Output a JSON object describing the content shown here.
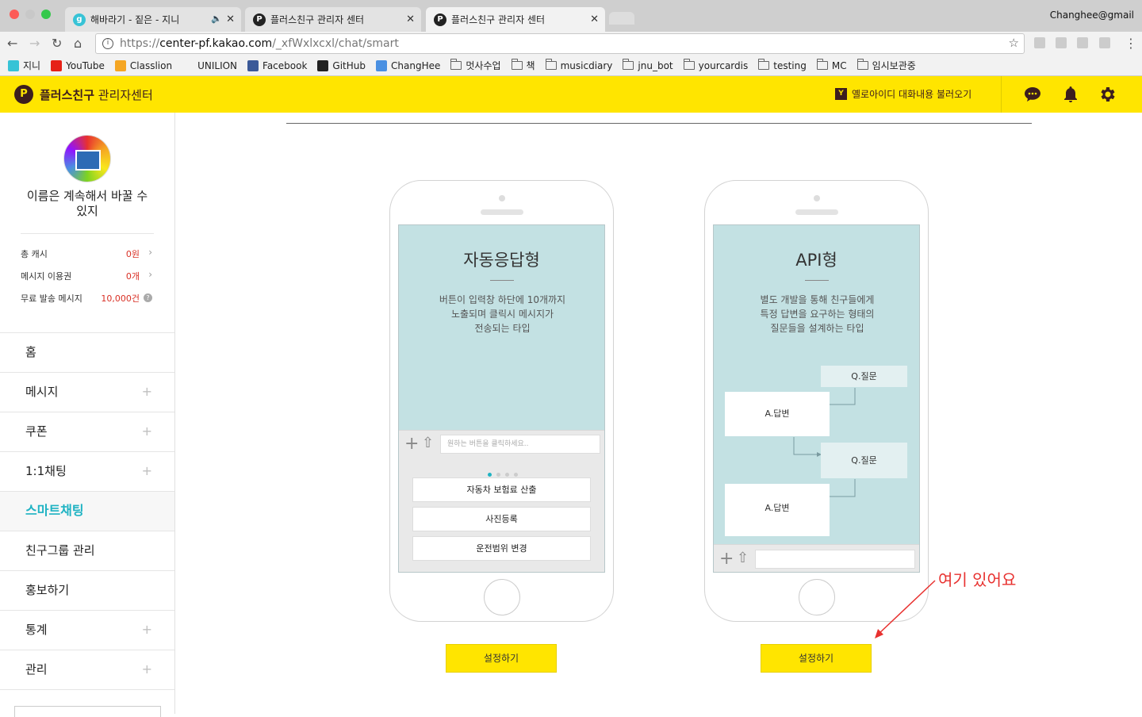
{
  "browser": {
    "tabs": [
      {
        "title": "해바라기 - 짙은 - 지니",
        "favicon_text": "g"
      },
      {
        "title": "플러스친구 관리자 센터",
        "favicon_text": "P"
      },
      {
        "title": "플러스친구 관리자 센터",
        "favicon_text": "P"
      }
    ],
    "profile": "Changhee@gmail",
    "url": {
      "scheme": "https://",
      "host": "center-pf.kakao.com",
      "path": "/_xfWxlxcxl/chat/smart"
    },
    "bookmarks": [
      {
        "label": "지니",
        "type": "site",
        "icon": "genie-icon"
      },
      {
        "label": "YouTube",
        "type": "site",
        "icon": "youtube-icon"
      },
      {
        "label": "Classlion",
        "type": "site",
        "icon": "classlion-icon"
      },
      {
        "label": "UNILION",
        "type": "site",
        "icon": "unilion-icon"
      },
      {
        "label": "Facebook",
        "type": "site",
        "icon": "facebook-icon"
      },
      {
        "label": "GitHub",
        "type": "site",
        "icon": "github-icon"
      },
      {
        "label": "ChangHee",
        "type": "site",
        "icon": "changhee-icon"
      },
      {
        "label": "멋사수업",
        "type": "folder"
      },
      {
        "label": "책",
        "type": "folder"
      },
      {
        "label": "musicdiary",
        "type": "folder"
      },
      {
        "label": "jnu_bot",
        "type": "folder"
      },
      {
        "label": "yourcardis",
        "type": "folder"
      },
      {
        "label": "testing",
        "type": "folder"
      },
      {
        "label": "MC",
        "type": "folder"
      },
      {
        "label": "임시보관중",
        "type": "folder"
      }
    ]
  },
  "header": {
    "logo_letter": "P",
    "brand_bold": "플러스친구",
    "brand_rest": " 관리자센터",
    "yellowid_badge": "Y",
    "yellowid_label": "옐로아이디 대화내용 불러오기",
    "accent": "#ffe500"
  },
  "sidebar": {
    "profile_name": "이름은 계속해서 바꿀 수 있지",
    "stats": [
      {
        "label": "총 캐시",
        "value": "0원"
      },
      {
        "label": "메시지 이용권",
        "value": "0개"
      },
      {
        "label": "무료 발송 메시지",
        "value": "10,000건"
      }
    ],
    "menu": [
      {
        "label": "홈",
        "expandable": false,
        "active": false
      },
      {
        "label": "메시지",
        "expandable": true,
        "active": false
      },
      {
        "label": "쿠폰",
        "expandable": true,
        "active": false
      },
      {
        "label": "1:1채팅",
        "expandable": true,
        "active": false
      },
      {
        "label": "스마트채팅",
        "expandable": false,
        "active": true
      },
      {
        "label": "친구그룹 관리",
        "expandable": false,
        "active": false
      },
      {
        "label": "홍보하기",
        "expandable": false,
        "active": false
      },
      {
        "label": "통계",
        "expandable": true,
        "active": false
      },
      {
        "label": "관리",
        "expandable": true,
        "active": false
      }
    ],
    "plus_symbol": "+"
  },
  "cards": {
    "auto": {
      "title": "자동응답형",
      "desc": [
        "버튼이 입력창 하단에 10개까지",
        "노출되며 클릭시 메시지가",
        "전송되는 타입"
      ],
      "input_placeholder": "원하는 버튼을 클릭하세요..",
      "buttons": [
        "자동차 보험료 산출",
        "사진등록",
        "운전범위 변경"
      ],
      "setup_label": "설정하기"
    },
    "api": {
      "title": "API형",
      "desc": [
        "별도 개발을 통해 친구들에게",
        "특정 답변을 요구하는 형태의",
        "질문들을 설계하는 타입"
      ],
      "flow": [
        "Q.질문",
        "A.답변",
        "Q.질문",
        "A.답변"
      ],
      "setup_label": "설정하기"
    }
  },
  "annotation": {
    "text": "여기 있어요",
    "color": "#e8312f"
  }
}
